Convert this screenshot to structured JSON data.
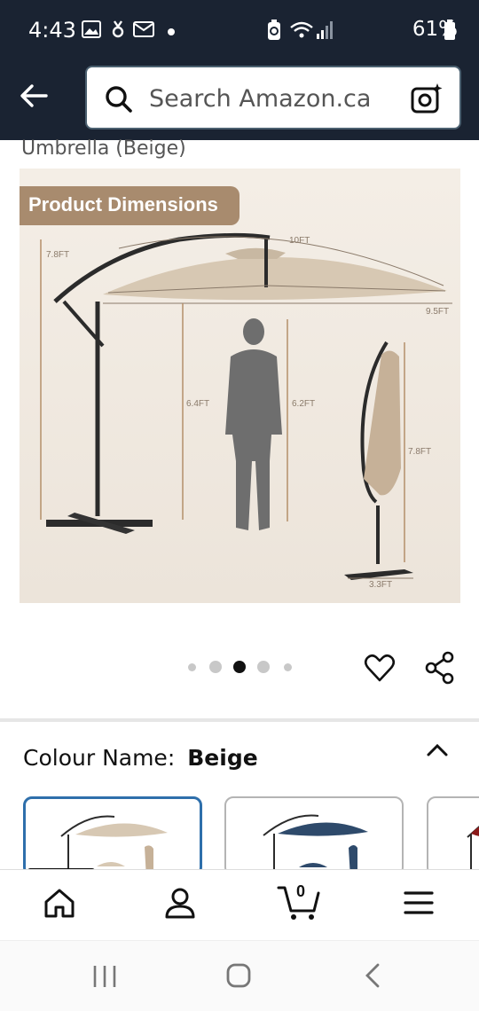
{
  "status_bar": {
    "time": "4:43",
    "battery": "61%"
  },
  "search": {
    "placeholder": "Search Amazon.ca"
  },
  "product": {
    "subtitle": "Umbrella (Beige)",
    "image_badge": "Product Dimensions",
    "dimension_labels": {
      "total_height": "7.8FT",
      "canopy_arc": "10FT",
      "canopy_width": "9.5FT",
      "clearance": "6.4FT",
      "person_height": "6.2FT",
      "folded_height": "7.8FT",
      "base_width": "3.3FT"
    },
    "gallery": {
      "count": 5,
      "active_index": 2
    }
  },
  "colour": {
    "label": "Colour Name:",
    "value": "Beige"
  },
  "swatches": [
    {
      "name": "Beige",
      "color": "#d9cbb8",
      "selected": true
    },
    {
      "name": "Navy",
      "color": "#2e4a6b",
      "selected": false
    },
    {
      "name": "Red",
      "color": "#8b1a1a",
      "selected": false
    }
  ],
  "bottom_nav": {
    "cart_count": "0",
    "items": [
      "home-icon",
      "account-icon",
      "cart-icon",
      "menu-icon"
    ]
  },
  "colors": {
    "header_bg": "#1a2332",
    "selected_border": "#2e6fab",
    "badge_bg": "#a88b6e"
  }
}
